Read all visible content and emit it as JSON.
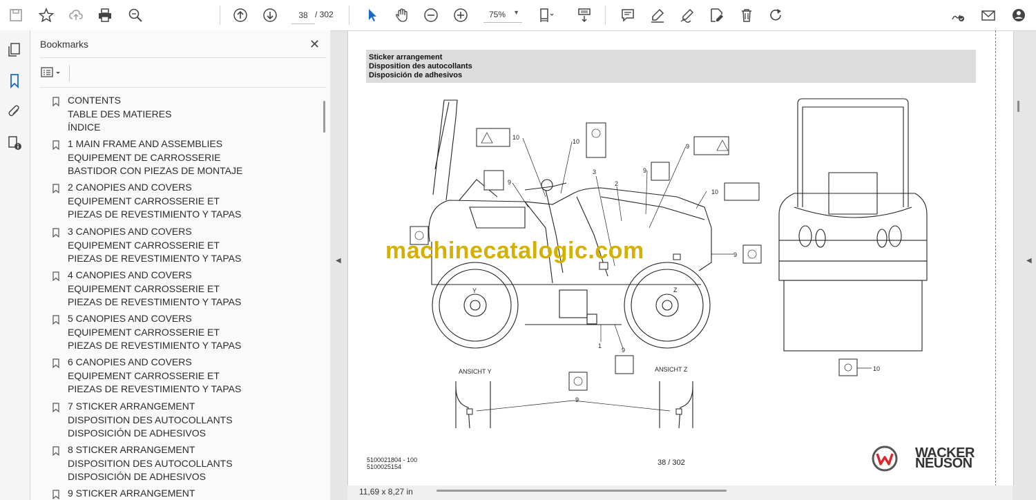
{
  "toolbar": {
    "current_page": "38",
    "total_pages": "/ 302",
    "zoom": "75%"
  },
  "bookmarks": {
    "title": "Bookmarks",
    "close": "✕",
    "items": [
      {
        "label": "CONTENTS\nTABLE DES MATIERES\nÍNDICE"
      },
      {
        "label": "1 MAIN FRAME AND ASSEMBLIES\nEQUIPEMENT DE CARROSSERIE\nBASTIDOR CON PIEZAS DE MONTAJE"
      },
      {
        "label": "2 CANOPIES AND COVERS\nEQUIPEMENT CARROSSERIE ET\nPIEZAS DE REVESTIMIENTO Y TAPAS"
      },
      {
        "label": "3 CANOPIES AND COVERS\nEQUIPEMENT CARROSSERIE ET\nPIEZAS DE REVESTIMIENTO Y TAPAS"
      },
      {
        "label": "4 CANOPIES AND COVERS\nEQUIPEMENT CARROSSERIE ET\nPIEZAS DE REVESTIMIENTO Y TAPAS"
      },
      {
        "label": "5 CANOPIES AND COVERS\nEQUIPEMENT CARROSSERIE ET\nPIEZAS DE REVESTIMIENTO Y TAPAS"
      },
      {
        "label": "6 CANOPIES AND COVERS\nEQUIPEMENT CARROSSERIE ET\nPIEZAS DE REVESTIMIENTO Y TAPAS"
      },
      {
        "label": "7 STICKER ARRANGEMENT\nDISPOSITION DES AUTOCOLLANTS\nDISPOSICIÓN DE ADHESIVOS"
      },
      {
        "label": "8 STICKER ARRANGEMENT\nDISPOSITION DES AUTOCOLLANTS\nDISPOSICIÓN DE ADHESIVOS"
      },
      {
        "label": "9 STICKER ARRANGEMENT"
      }
    ]
  },
  "document": {
    "header": [
      "Sticker arrangement",
      "Disposition des autocollants",
      "Disposición de adhesivos"
    ],
    "watermark": "machinecatalogic.com",
    "view_y": "ANSICHT Y",
    "view_z": "ANSICHT Z",
    "footer_code_1": "5100021804 - 100",
    "footer_code_2": "5100025154",
    "footer_page": "38 / 302",
    "brand_1": "WACKER",
    "brand_2": "NEUSON",
    "callouts": {
      "c10a": "10",
      "c10b": "10",
      "c9a": "9",
      "c9b": "9",
      "c9c": "9",
      "c3": "3",
      "c2": "2",
      "c10c": "10",
      "c9d": "9",
      "c1": "1",
      "c9e": "9",
      "c9f": "9",
      "c10d": "10",
      "cY": "Y",
      "cZ": "Z"
    }
  },
  "status": {
    "dimensions": "11,69 x 8,27 in"
  }
}
